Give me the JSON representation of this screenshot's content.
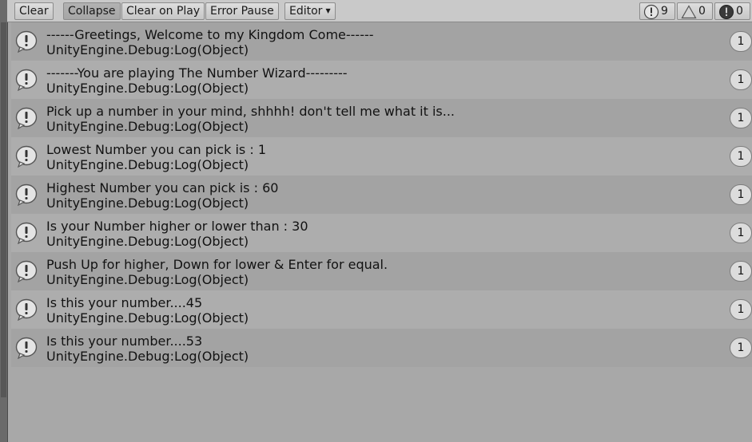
{
  "toolbar": {
    "clear_label": "Clear",
    "collapse_label": "Collapse",
    "clear_on_play_label": "Clear on Play",
    "error_pause_label": "Error Pause",
    "editor_label": "Editor",
    "info_count": "9",
    "warning_count": "0",
    "error_count": "0"
  },
  "entries": [
    {
      "line1": "------Greetings, Welcome to my Kingdom Come------",
      "line2": "UnityEngine.Debug:Log(Object)",
      "count": "1"
    },
    {
      "line1": "-------You are playing The Number Wizard---------",
      "line2": "UnityEngine.Debug:Log(Object)",
      "count": "1"
    },
    {
      "line1": "Pick up a number in your mind, shhhh! don't tell me what it is...",
      "line2": "UnityEngine.Debug:Log(Object)",
      "count": "1"
    },
    {
      "line1": "Lowest Number you can pick is : 1",
      "line2": "UnityEngine.Debug:Log(Object)",
      "count": "1"
    },
    {
      "line1": "Highest Number you can pick is : 60",
      "line2": "UnityEngine.Debug:Log(Object)",
      "count": "1"
    },
    {
      "line1": "Is your Number higher or lower than : 30",
      "line2": "UnityEngine.Debug:Log(Object)",
      "count": "1"
    },
    {
      "line1": "Push Up for higher, Down for lower & Enter for equal.",
      "line2": "UnityEngine.Debug:Log(Object)",
      "count": "1"
    },
    {
      "line1": "Is this your number....45",
      "line2": "UnityEngine.Debug:Log(Object)",
      "count": "1"
    },
    {
      "line1": "Is this your number....53",
      "line2": "UnityEngine.Debug:Log(Object)",
      "count": "1"
    }
  ]
}
